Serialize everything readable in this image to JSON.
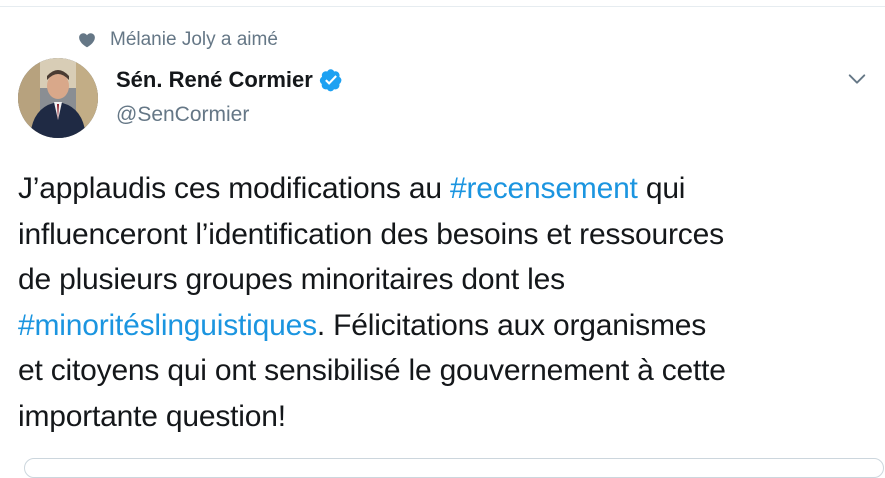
{
  "social_context": {
    "text": "Mélanie Joly a aimé",
    "icon": "heart-icon"
  },
  "author": {
    "display_name": "Sén. René Cormier",
    "handle": "@SenCormier",
    "verified": true,
    "verified_color": "#1da1f2"
  },
  "tweet": {
    "lines": [
      [
        "J’applaudis ces modifications au ",
        "#recensement",
        " qui"
      ],
      [
        "influenceront l’identification des besoins et ressources"
      ],
      [
        "de plusieurs groupes minoritaires dont les"
      ],
      [
        "",
        "#minoritéslinguistiques",
        ". Félicitations aux organismes"
      ],
      [
        "et citoyens qui ont sensibilisé le gouvernement à cette"
      ],
      [
        "importante question!"
      ]
    ],
    "hashtags": [
      "#recensement",
      "#minoritéslinguistiques"
    ]
  },
  "colors": {
    "text": "#14171a",
    "muted": "#657786",
    "link": "#1b95e0"
  }
}
